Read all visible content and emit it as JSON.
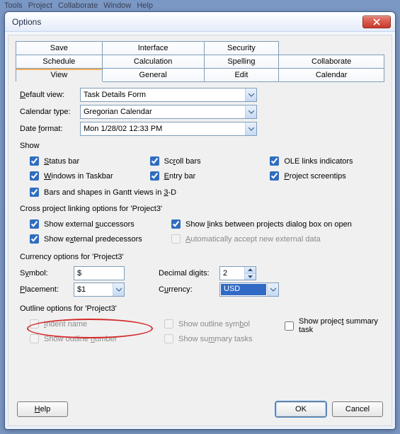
{
  "bg_menu": [
    "Tools",
    "Project",
    "Collaborate",
    "Window",
    "Help"
  ],
  "title": "Options",
  "tabs": {
    "row1": [
      "Save",
      "Interface",
      "Security",
      ""
    ],
    "row2": [
      "Schedule",
      "Calculation",
      "Spelling",
      "Collaborate"
    ],
    "row3": [
      "View",
      "General",
      "Edit",
      "Calendar"
    ],
    "active": "View"
  },
  "view": {
    "default_view_label": "Default view:",
    "default_view_value": "Task Details Form",
    "calendar_type_label": "Calendar type:",
    "calendar_type_value": "Gregorian Calendar",
    "date_format_label": "Date format:",
    "date_format_value": "Mon 1/28/02 12:33 PM"
  },
  "show": {
    "group": "Show",
    "status_bar": "Status bar",
    "windows_taskbar": "Windows in Taskbar",
    "bars_shapes_gantt": "Bars and shapes in Gantt views in 3-D",
    "scroll_bars": "Scroll bars",
    "entry_bar": "Entry bar",
    "ole_links": "OLE links indicators",
    "screentips": "Project screentips"
  },
  "cross": {
    "group": "Cross project linking options for 'Project3'",
    "ext_succ": "Show external successors",
    "ext_pred": "Show external predecessors",
    "show_links_dialog": "Show links between projects dialog box on open",
    "auto_accept": "Automatically accept new external data"
  },
  "currency": {
    "group": "Currency options for 'Project3'",
    "symbol_label": "Symbol:",
    "symbol_value": "$",
    "placement_label": "Placement:",
    "placement_value": "$1",
    "decimal_label": "Decimal digits:",
    "decimal_value": "2",
    "currency_label": "Currency:",
    "currency_value": "USD"
  },
  "outline": {
    "group": "Outline options for 'Project3'",
    "indent_name": "Indent name",
    "show_outline_number": "Show outline number",
    "show_outline_symbol": "Show outline symbol",
    "show_summary_tasks": "Show summary tasks",
    "project_summary_task": "Show project summary task"
  },
  "buttons": {
    "help": "Help",
    "ok": "OK",
    "cancel": "Cancel"
  }
}
